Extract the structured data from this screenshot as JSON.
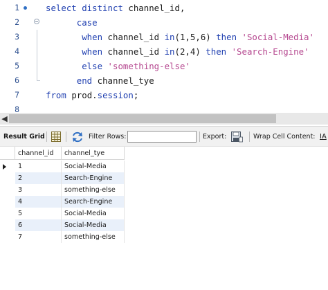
{
  "editor": {
    "lines": [
      {
        "num": "1",
        "parts": [
          {
            "t": "select distinct ",
            "c": "kw"
          },
          {
            "t": "channel_id,",
            "c": "plain"
          }
        ]
      },
      {
        "num": "2",
        "parts": [
          {
            "t": "      case",
            "c": "kw"
          }
        ]
      },
      {
        "num": "3",
        "parts": [
          {
            "t": "       when ",
            "c": "kw"
          },
          {
            "t": "channel_id ",
            "c": "plain"
          },
          {
            "t": "in",
            "c": "kw"
          },
          {
            "t": "(1,5,6) ",
            "c": "plain"
          },
          {
            "t": "then ",
            "c": "kw"
          },
          {
            "t": "'Social-Media'",
            "c": "str"
          }
        ]
      },
      {
        "num": "4",
        "parts": [
          {
            "t": "       when ",
            "c": "kw"
          },
          {
            "t": "channel_id ",
            "c": "plain"
          },
          {
            "t": "in",
            "c": "kw"
          },
          {
            "t": "(2,4) ",
            "c": "plain"
          },
          {
            "t": "then ",
            "c": "kw"
          },
          {
            "t": "'Search-Engine'",
            "c": "str"
          }
        ]
      },
      {
        "num": "5",
        "parts": [
          {
            "t": "       else ",
            "c": "kw"
          },
          {
            "t": "'something-else'",
            "c": "str"
          }
        ]
      },
      {
        "num": "6",
        "parts": [
          {
            "t": "      end ",
            "c": "kw"
          },
          {
            "t": "channel_tye",
            "c": "plain"
          }
        ]
      },
      {
        "num": "7",
        "parts": [
          {
            "t": "from ",
            "c": "kw"
          },
          {
            "t": "prod.",
            "c": "plain"
          },
          {
            "t": "session",
            "c": "kw"
          },
          {
            "t": ";",
            "c": "plain"
          }
        ]
      },
      {
        "num": "8",
        "parts": []
      }
    ]
  },
  "toolbar": {
    "result_grid_label": "Result Grid",
    "filter_rows_label": "Filter Rows:",
    "filter_value": "",
    "export_label": "Export:",
    "wrap_label": "Wrap Cell Content:",
    "wrap_icon_glyph": "IA"
  },
  "grid": {
    "columns": [
      "channel_id",
      "channel_tye"
    ],
    "rows": [
      [
        "1",
        "Social-Media"
      ],
      [
        "2",
        "Search-Engine"
      ],
      [
        "3",
        "something-else"
      ],
      [
        "4",
        "Search-Engine"
      ],
      [
        "5",
        "Social-Media"
      ],
      [
        "6",
        "Social-Media"
      ],
      [
        "7",
        "something-else"
      ]
    ]
  },
  "colors": {
    "keyword": "#1f3fb0",
    "string": "#b5478f",
    "alt_row": "#e9f0fa",
    "line_number": "#2c4f8f"
  },
  "icons": {
    "result_grid": "grid-icon",
    "filter": "filter-refresh-icon",
    "export": "export-save-icon",
    "wrap": "wrap-cell-icon",
    "scroll_left": "scroll-left-arrow-icon",
    "row_indicator": "current-row-arrow-icon",
    "breakpoint": "statement-marker-icon"
  }
}
